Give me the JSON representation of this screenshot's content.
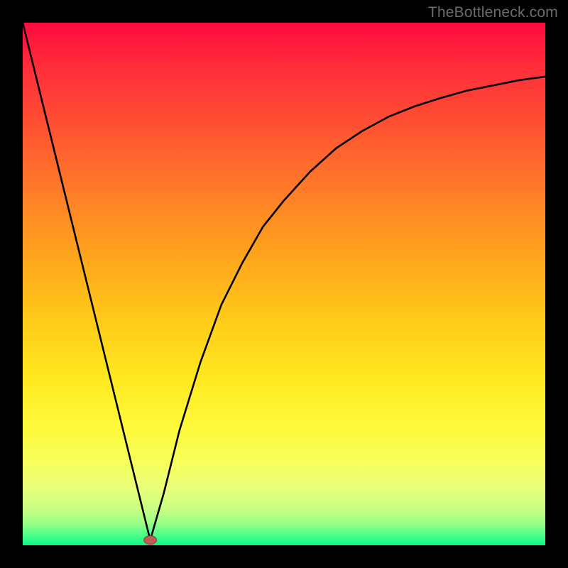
{
  "attribution": "TheBottleneck.com",
  "chart_data": {
    "type": "line",
    "title": "",
    "xlabel": "",
    "ylabel": "",
    "xlim": [
      0,
      100
    ],
    "ylim": [
      0,
      100
    ],
    "series": [
      {
        "name": "left-branch",
        "x": [
          0,
          24.4
        ],
        "values": [
          100,
          1
        ]
      },
      {
        "name": "right-branch",
        "x": [
          24.4,
          27,
          30,
          34,
          38,
          42,
          46,
          50,
          55,
          60,
          65,
          70,
          75,
          80,
          85,
          90,
          95,
          100
        ],
        "values": [
          1,
          10,
          22,
          35,
          46,
          54,
          61,
          66,
          71.5,
          76,
          79.3,
          82,
          84,
          85.6,
          87,
          88,
          89,
          89.7
        ]
      }
    ],
    "marker": {
      "x": 24.4,
      "y": 1,
      "color": "#c25b55"
    },
    "background_gradient": {
      "top": "#ff0a3f",
      "bottom": "#10f786",
      "stops": [
        "red",
        "orange",
        "yellow",
        "green"
      ]
    }
  }
}
